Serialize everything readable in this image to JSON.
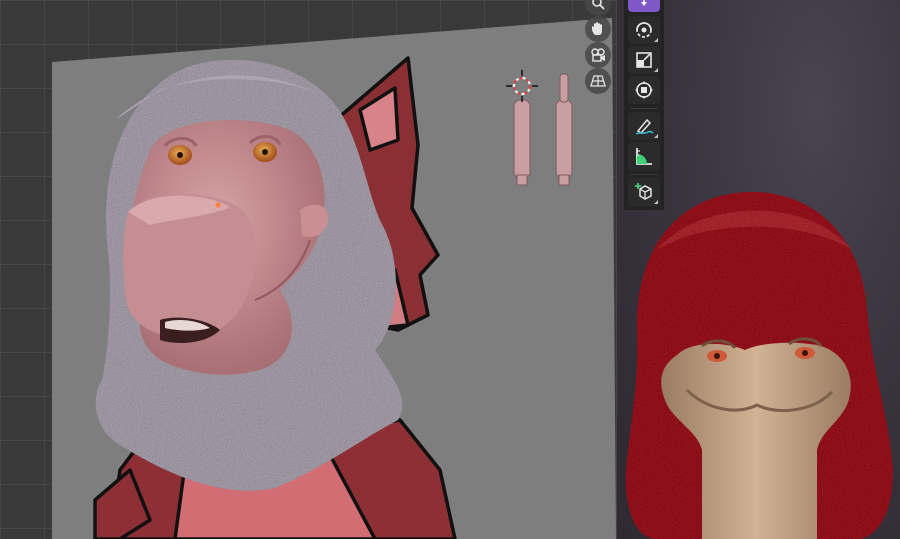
{
  "app": {
    "type": "3D viewport",
    "accent_color": "#7f58c8"
  },
  "navigation_gizmo": {
    "buttons": [
      {
        "icon": "zoom-magnifier-icon"
      },
      {
        "icon": "pan-hand-icon"
      },
      {
        "icon": "camera-view-icon"
      },
      {
        "icon": "perspective-grid-icon"
      }
    ]
  },
  "toolbar": {
    "tools": [
      {
        "icon": "cursor-tool-icon",
        "active": true
      },
      {
        "icon": "rotate-tool-icon",
        "active": false
      },
      {
        "icon": "scale-tool-icon",
        "active": false
      },
      {
        "icon": "transform-tool-icon",
        "active": false
      },
      {
        "icon": "annotate-tool-icon",
        "active": false
      },
      {
        "icon": "measure-tool-icon",
        "active": false
      },
      {
        "icon": "add-cube-tool-icon",
        "active": false
      }
    ]
  },
  "scene": {
    "fur_color_main": "#8b7e90",
    "fur_color_preview": "#a61e27",
    "skin_color": "#c98f92",
    "reference_sketch_color": "#7a2a2c"
  }
}
